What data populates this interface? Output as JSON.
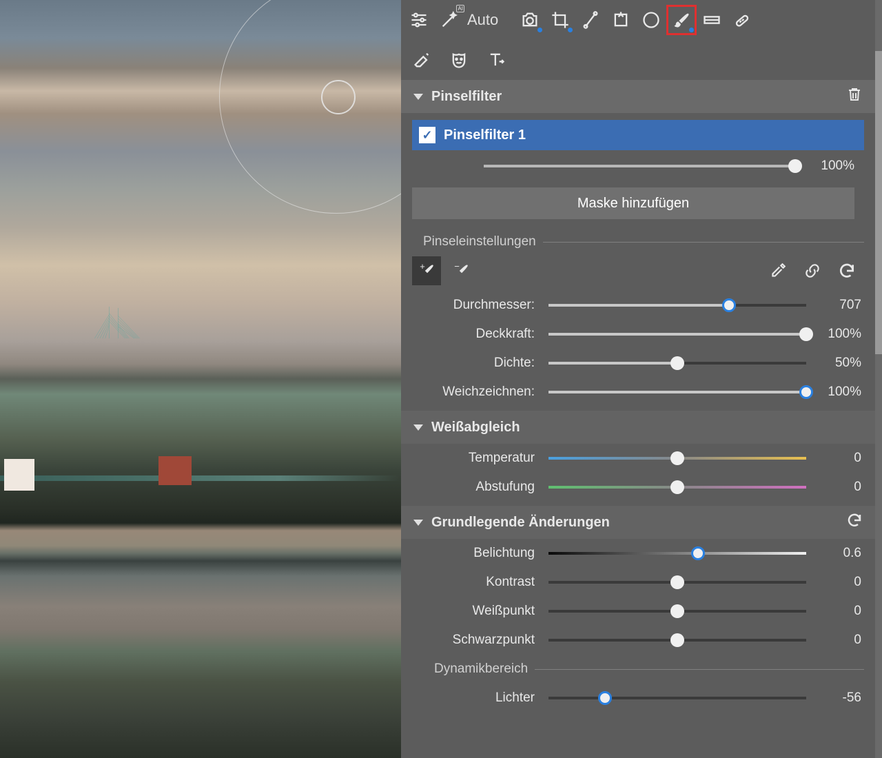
{
  "toolbar": {
    "auto": "Auto"
  },
  "panel": {
    "title": "Pinselfilter",
    "filter_name": "Pinselfilter 1",
    "filter_opacity_value": "100%",
    "add_mask": "Maske hinzufügen"
  },
  "brush_settings": {
    "title": "Pinseleinstellungen",
    "diameter_label": "Durchmesser:",
    "diameter_value": "707",
    "opacity_label": "Deckkraft:",
    "opacity_value": "100%",
    "density_label": "Dichte:",
    "density_value": "50%",
    "feather_label": "Weichzeichnen:",
    "feather_value": "100%"
  },
  "white_balance": {
    "title": "Weißabgleich",
    "temperature_label": "Temperatur",
    "temperature_value": "0",
    "tint_label": "Abstufung",
    "tint_value": "0"
  },
  "basic": {
    "title": "Grundlegende Änderungen",
    "exposure_label": "Belichtung",
    "exposure_value": "0.6",
    "contrast_label": "Kontrast",
    "contrast_value": "0",
    "white_label": "Weißpunkt",
    "white_value": "0",
    "black_label": "Schwarzpunkt",
    "black_value": "0",
    "dynamic_label": "Dynamikbereich",
    "highlights_label": "Lichter",
    "highlights_value": "-56"
  }
}
